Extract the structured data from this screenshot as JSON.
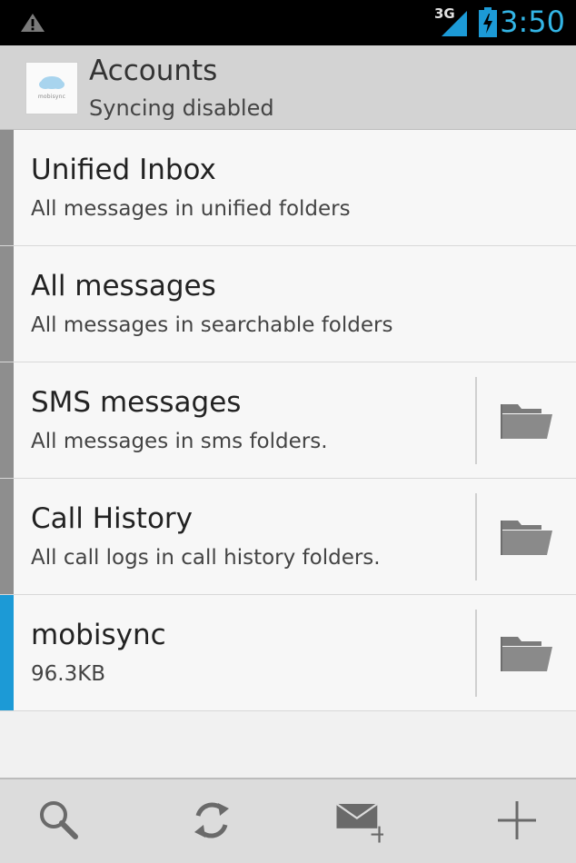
{
  "status_bar": {
    "network": "3G",
    "time": "3:50",
    "accent_color": "#33b5e5"
  },
  "header": {
    "logo_text": "mobisync",
    "title": "Accounts",
    "subtitle": "Syncing disabled"
  },
  "folders": [
    {
      "title": "Unified Inbox",
      "subtitle": "All messages in unified folders",
      "active": false,
      "has_folder_button": false
    },
    {
      "title": "All messages",
      "subtitle": "All messages in searchable folders",
      "active": false,
      "has_folder_button": false
    },
    {
      "title": "SMS messages",
      "subtitle": "All messages in sms folders.",
      "active": false,
      "has_folder_button": true
    },
    {
      "title": "Call History",
      "subtitle": "All call logs in call history folders.",
      "active": false,
      "has_folder_button": true
    },
    {
      "title": "mobisync",
      "subtitle": "96.3KB",
      "active": true,
      "has_folder_button": true
    }
  ],
  "bottom_bar": {
    "actions": [
      {
        "icon": "search-icon"
      },
      {
        "icon": "refresh-icon"
      },
      {
        "icon": "compose-icon"
      },
      {
        "icon": "add-icon"
      }
    ]
  },
  "colors": {
    "active_accent": "#1c9ad6",
    "inactive_accent": "#8e8e8e"
  }
}
